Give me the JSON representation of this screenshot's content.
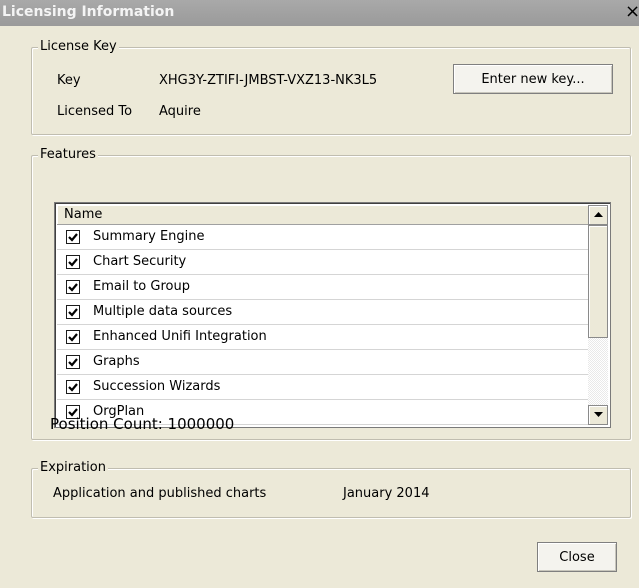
{
  "window": {
    "title": "Licensing Information",
    "close_glyph": "×"
  },
  "license_key": {
    "legend": "License Key",
    "key_label": "Key",
    "key_value": "XHG3Y-ZTIFI-JMBST-VXZ13-NK3L5",
    "licensed_to_label": "Licensed To",
    "licensed_to_value": "Aquire",
    "enter_new_key_button": "Enter new key..."
  },
  "features": {
    "legend": "Features",
    "column_header": "Name",
    "items": [
      {
        "label": "Summary Engine",
        "checked": true
      },
      {
        "label": "Chart Security",
        "checked": true
      },
      {
        "label": "Email to Group",
        "checked": true
      },
      {
        "label": "Multiple data sources",
        "checked": true
      },
      {
        "label": "Enhanced Unifi Integration",
        "checked": true
      },
      {
        "label": "Graphs",
        "checked": true
      },
      {
        "label": "Succession Wizards",
        "checked": true
      },
      {
        "label": "OrgPlan",
        "checked": true
      }
    ],
    "position_count": "Position Count: 1000000"
  },
  "expiration": {
    "legend": "Expiration",
    "label": "Application and published charts",
    "value": "January 2014"
  },
  "footer": {
    "close_button": "Close"
  }
}
